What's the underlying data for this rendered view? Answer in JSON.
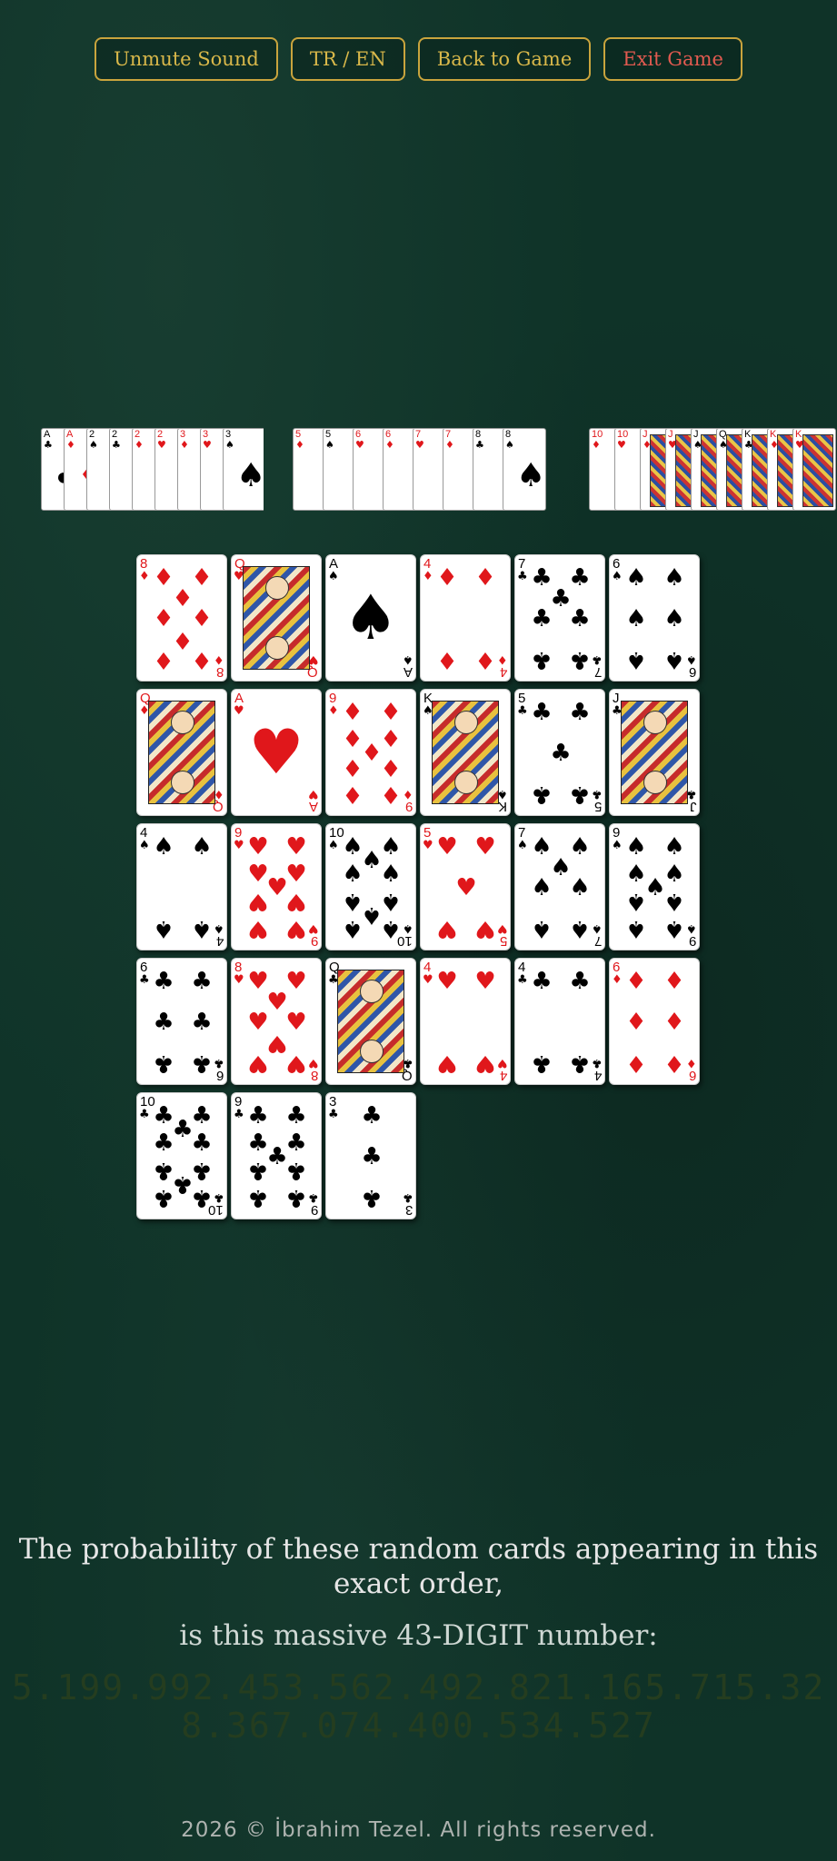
{
  "toolbar": {
    "unmute_label": "Unmute Sound",
    "lang_label": "TR / EN",
    "back_label": "Back to Game",
    "exit_label": "Exit Game"
  },
  "colors": {
    "accent": "#c9a43d",
    "exit": "#e25a50",
    "felt": "#0f3328",
    "red_suit": "#e0171b"
  },
  "sorted_strips": [
    {
      "cards": [
        {
          "rank": "A",
          "suit": "♣"
        },
        {
          "rank": "A",
          "suit": "♦"
        },
        {
          "rank": "2",
          "suit": "♠"
        },
        {
          "rank": "2",
          "suit": "♣"
        },
        {
          "rank": "2",
          "suit": "♦"
        },
        {
          "rank": "2",
          "suit": "♥"
        },
        {
          "rank": "3",
          "suit": "♦"
        },
        {
          "rank": "3",
          "suit": "♥"
        },
        {
          "rank": "3",
          "suit": "♠"
        }
      ]
    },
    {
      "cards": [
        {
          "rank": "5",
          "suit": "♦"
        },
        {
          "rank": "5",
          "suit": "♠"
        },
        {
          "rank": "6",
          "suit": "♥"
        },
        {
          "rank": "6",
          "suit": "♦"
        },
        {
          "rank": "7",
          "suit": "♥"
        },
        {
          "rank": "7",
          "suit": "♦"
        },
        {
          "rank": "8",
          "suit": "♣"
        },
        {
          "rank": "8",
          "suit": "♠"
        }
      ]
    },
    {
      "cards": [
        {
          "rank": "10",
          "suit": "♦"
        },
        {
          "rank": "10",
          "suit": "♥"
        },
        {
          "rank": "J",
          "suit": "♦"
        },
        {
          "rank": "J",
          "suit": "♥"
        },
        {
          "rank": "J",
          "suit": "♠"
        },
        {
          "rank": "Q",
          "suit": "♠"
        },
        {
          "rank": "K",
          "suit": "♣"
        },
        {
          "rank": "K",
          "suit": "♦"
        },
        {
          "rank": "K",
          "suit": "♥"
        }
      ]
    }
  ],
  "cards": [
    {
      "rank": "8",
      "suit": "♦"
    },
    {
      "rank": "Q",
      "suit": "♥"
    },
    {
      "rank": "A",
      "suit": "♠"
    },
    {
      "rank": "4",
      "suit": "♦"
    },
    {
      "rank": "7",
      "suit": "♣"
    },
    {
      "rank": "6",
      "suit": "♠"
    },
    {
      "rank": "Q",
      "suit": "♦"
    },
    {
      "rank": "A",
      "suit": "♥"
    },
    {
      "rank": "9",
      "suit": "♦"
    },
    {
      "rank": "K",
      "suit": "♠"
    },
    {
      "rank": "5",
      "suit": "♣"
    },
    {
      "rank": "J",
      "suit": "♣"
    },
    {
      "rank": "4",
      "suit": "♠"
    },
    {
      "rank": "9",
      "suit": "♥"
    },
    {
      "rank": "10",
      "suit": "♠"
    },
    {
      "rank": "5",
      "suit": "♥"
    },
    {
      "rank": "7",
      "suit": "♠"
    },
    {
      "rank": "9",
      "suit": "♠"
    },
    {
      "rank": "6",
      "suit": "♣"
    },
    {
      "rank": "8",
      "suit": "♥"
    },
    {
      "rank": "Q",
      "suit": "♣"
    },
    {
      "rank": "4",
      "suit": "♥"
    },
    {
      "rank": "4",
      "suit": "♣"
    },
    {
      "rank": "6",
      "suit": "♦"
    },
    {
      "rank": "10",
      "suit": "♣"
    },
    {
      "rank": "9",
      "suit": "♣"
    },
    {
      "rank": "3",
      "suit": "♣"
    }
  ],
  "probability": {
    "line1": "The probability of these random cards appearing in this exact order,",
    "line2": "is this massive 43-DIGIT number:",
    "number_line1": "5.199.992.453.562.492.821.165.715.32",
    "number_line2": "8.367.074.400.534.527"
  },
  "footer": {
    "text": "2026 © İbrahim Tezel. All rights reserved."
  }
}
